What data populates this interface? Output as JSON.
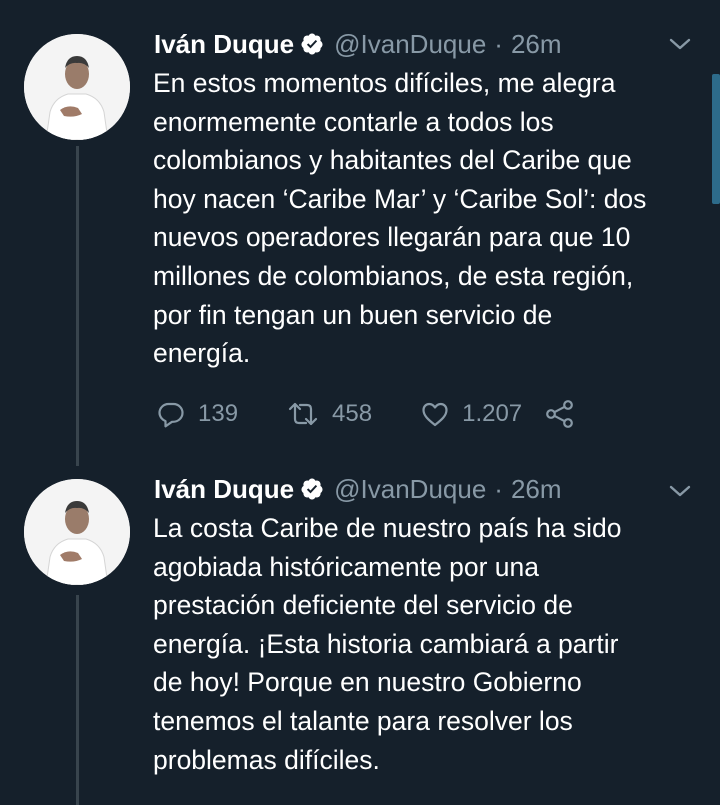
{
  "tweets": [
    {
      "author": {
        "name": "Iván Duque",
        "handle": "@IvanDuque",
        "verified": true,
        "avatar_icon": "avatar-photo"
      },
      "time": "26m",
      "separator": "·",
      "text": "En estos momentos difíciles, me alegra\nenormemente contarle a todos los\ncolombianos y habitantes del Caribe que\nhoy nacen ‘Caribe Mar’ y ‘Caribe Sol’: dos\nnuevos operadores llegarán para que 10\nmillones de colombianos, de esta región,\npor fin tengan un buen servicio de\nenergía.",
      "stats": {
        "replies": "139",
        "retweets": "458",
        "likes": "1.207"
      }
    },
    {
      "author": {
        "name": "Iván Duque",
        "handle": "@IvanDuque",
        "verified": true,
        "avatar_icon": "avatar-photo"
      },
      "time": "26m",
      "separator": "·",
      "text": "La costa Caribe de nuestro país ha sido\nagobiada históricamente por una\nprestación deficiente del servicio de\nenergía. ¡Esta historia cambiará a partir\nde hoy! Porque en nuestro Gobierno\ntenemos el  talante para resolver los\nproblemas difíciles."
    }
  ],
  "icons": [
    "verified-badge-icon",
    "chevron-down-icon",
    "reply-icon",
    "retweet-icon",
    "like-icon",
    "share-icon"
  ],
  "colors": {
    "background": "#15202b",
    "text_primary": "#ffffff",
    "text_secondary": "#8899a6",
    "thread_line": "#38444d",
    "scrollbar": "#2d6b8a"
  }
}
